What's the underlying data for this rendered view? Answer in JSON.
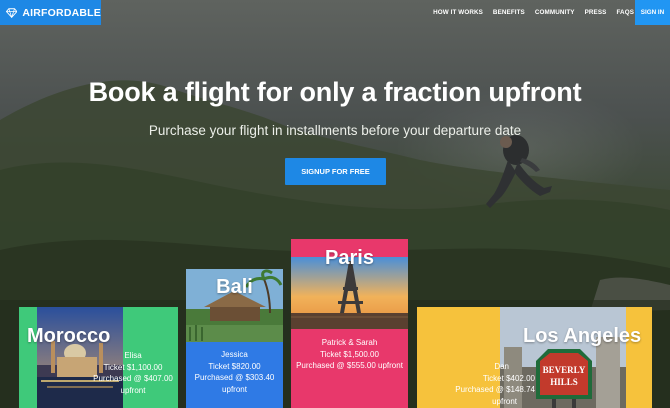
{
  "brand": {
    "name": "AIRFORDABLE",
    "logo_icon": "diamond-icon",
    "color": "#1e88e5"
  },
  "nav": {
    "items": [
      {
        "label": "HOW IT WORKS"
      },
      {
        "label": "BENEFITS"
      },
      {
        "label": "COMMUNITY"
      },
      {
        "label": "PRESS"
      },
      {
        "label": "FAQS"
      }
    ],
    "signin_label": "SIGN IN"
  },
  "hero": {
    "headline": "Book a flight for only a fraction upfront",
    "subheadline": "Purchase your flight in installments before your departure date",
    "cta_label": "SIGNUP FOR FREE"
  },
  "destinations": [
    {
      "city": "Morocco",
      "name": "Elisa",
      "ticket": "Ticket $1,100.00",
      "purchased": "Purchased @ $407.00",
      "upfront": "upfront",
      "color": "#3fc97a"
    },
    {
      "city": "Bali",
      "name": "Jessica",
      "ticket": "Ticket $820.00",
      "purchased": "Purchased @ $303.40",
      "upfront": "upfront",
      "color": "#2f7ae5"
    },
    {
      "city": "Paris",
      "name": "Patrick & Sarah",
      "ticket": "Ticket $1,500.00",
      "purchased": "Purchased @ $555.00 upfront",
      "color": "#e8386b"
    },
    {
      "city": "Los Angeles",
      "name": "Dan",
      "ticket": "Ticket $402.00",
      "purchased": "Purchased @ $148.74",
      "upfront": "upfront",
      "color": "#f6c23c"
    }
  ]
}
